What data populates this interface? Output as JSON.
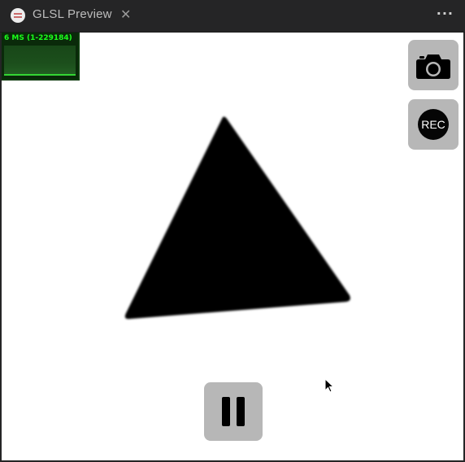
{
  "tab": {
    "title": "GLSL Preview",
    "close_glyph": "✕",
    "more_glyph": "···"
  },
  "stats": {
    "label": "6 MS (1-229184)"
  },
  "controls": {
    "screenshot_icon": "camera-icon",
    "record_label": "REC",
    "pause_icon": "pause-icon"
  },
  "colors": {
    "stats_text": "#1bff1b",
    "shape_fill": "#000000",
    "button_bg": "#b7b7b7"
  }
}
